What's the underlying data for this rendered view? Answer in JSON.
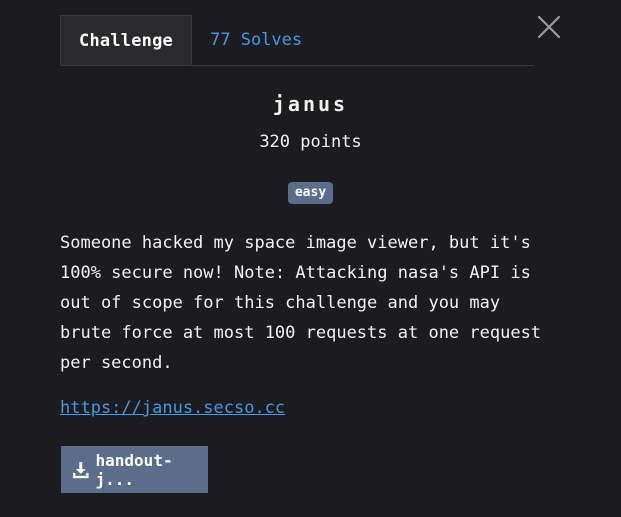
{
  "tabs": {
    "challenge_label": "Challenge",
    "solves_label": "77 Solves"
  },
  "challenge": {
    "name": "janus",
    "points": "320 points",
    "difficulty": "easy",
    "description": "Someone hacked my space image viewer, but it's 100% secure now! Note: Attacking nasa's API is out of scope for this challenge and you may brute force at most 100 requests at one request per second.",
    "link_text": "https://janus.secso.cc",
    "download_label": "handout-j..."
  },
  "icons": {
    "close": "close-icon",
    "download": "download-icon"
  },
  "colors": {
    "background": "#1c1c1e",
    "link": "#3d9be9",
    "badge": "#5a6e8c",
    "button": "#5a6e8c"
  }
}
